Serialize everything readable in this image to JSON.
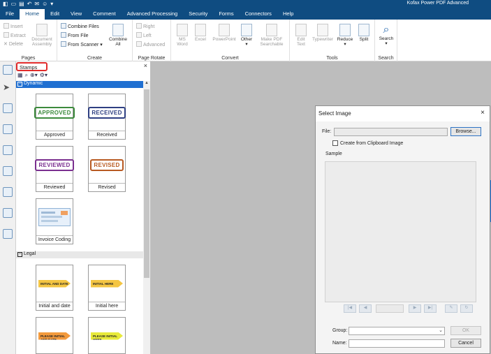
{
  "app": {
    "title": "Kofax Power PDF Advanced"
  },
  "menu": {
    "tabs": [
      "File",
      "Home",
      "Edit",
      "View",
      "Comment",
      "Advanced Processing",
      "Security",
      "Forms",
      "Connectors",
      "Help"
    ],
    "active_index": 1
  },
  "ribbon": {
    "pages": {
      "label": "Pages",
      "insert": "Insert",
      "extract": "Extract",
      "delete": "Delete",
      "document_assembly_1": "Document",
      "document_assembly_2": "Assembly"
    },
    "create": {
      "label": "Create",
      "combine_files": "Combine Files",
      "from_file": "From File",
      "from_scanner": "From Scanner",
      "combine_all_1": "Combine",
      "combine_all_2": "All"
    },
    "page_rotate": {
      "label": "Page Rotate",
      "right": "Right",
      "left": "Left",
      "advanced": "Advanced"
    },
    "convert": {
      "label": "Convert",
      "ms_word_1": "MS",
      "ms_word_2": "Word",
      "excel": "Excel",
      "powerpoint": "PowerPoint",
      "other": "Other",
      "make_pdf_1": "Make PDF",
      "make_pdf_2": "Searchable"
    },
    "tools": {
      "label": "Tools",
      "edit_text_1": "Edit",
      "edit_text_2": "Text",
      "typewriter": "Typewriter",
      "reduce": "Reduce",
      "split": "Split"
    },
    "search": {
      "label": "Search",
      "search": "Search"
    }
  },
  "panel": {
    "title": "Stamps",
    "close": "×",
    "sections": {
      "dynamic": "Dynamic",
      "legal": "Legal"
    },
    "stamps": {
      "approved": {
        "art": "APPROVED",
        "caption": "Approved"
      },
      "received": {
        "art": "RECEIVED",
        "caption": "Received"
      },
      "reviewed": {
        "art": "REVIEWED",
        "caption": "Reviewed"
      },
      "revised": {
        "art": "REVISED",
        "caption": "Revised"
      },
      "invoice": {
        "caption": "Invoice Coding"
      },
      "initial_date": {
        "art": "INITIAL AND DATE",
        "caption": "Initial and date"
      },
      "initial_here": {
        "art": "INITIAL HERE",
        "caption": "Initial here"
      },
      "please_initial_date": {
        "art": "PLEASE INITIAL AND DATE"
      },
      "please_initial_here": {
        "art": "PLEASE INITIAL HERE"
      }
    },
    "colors": {
      "approved": "#3b8a3b",
      "received": "#2e3f82",
      "reviewed": "#7a2f8f",
      "revised": "#b85a22",
      "tag_yellow": "#f4c542",
      "tag_orange": "#f39a3d",
      "tag_lime": "#e8ea3a"
    }
  },
  "dialog": {
    "title": "Select Image",
    "close": "×",
    "file_label": "File:",
    "file_value": "",
    "browse": "Browse...",
    "clipboard_label": "Create from Clipboard Image",
    "sample_label": "Sample",
    "group_label": "Group:",
    "group_value": "",
    "name_label": "Name:",
    "name_value": "",
    "ok": "OK",
    "cancel": "Cancel"
  }
}
